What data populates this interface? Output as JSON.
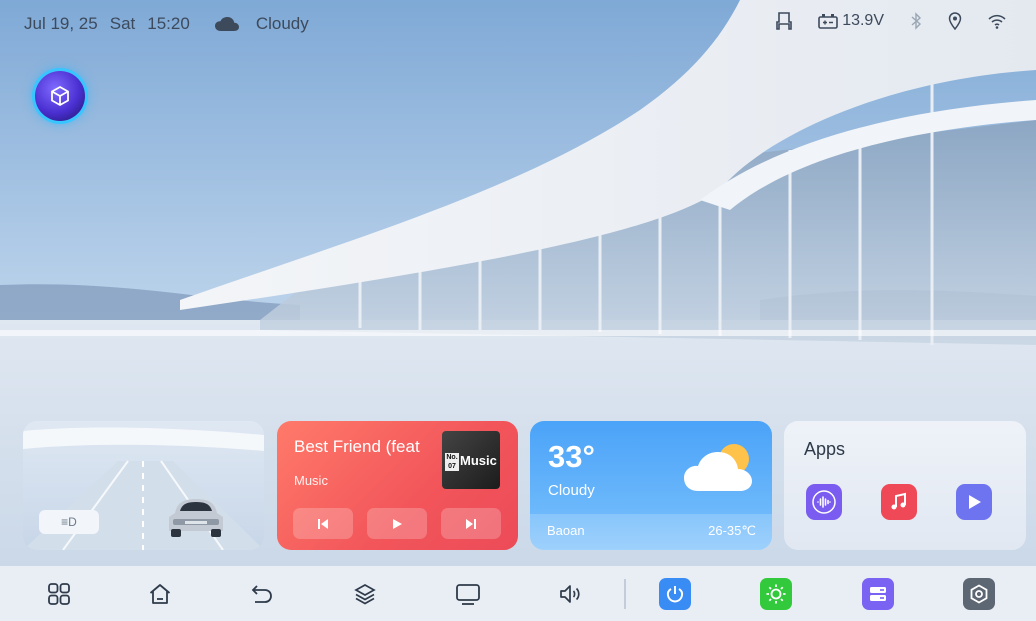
{
  "status_bar": {
    "date": "Jul 19, 25",
    "day": "Sat",
    "time": "15:20",
    "weather": "Cloudy",
    "icons": [
      "cloud-icon",
      "seat-icon",
      "battery-icon",
      "bluetooth-icon",
      "location-icon",
      "wifi-icon"
    ],
    "battery_voltage": "13.9V"
  },
  "assistant": {
    "icon": "cube-icon"
  },
  "vehicle_card": {
    "light_label": "≡D",
    "icons": [
      "car-icon",
      "headlight-icon"
    ]
  },
  "music_card": {
    "title": "Best Friend (feat",
    "subtitle": "Music",
    "album_label": "Music",
    "album_tag": "No. 07",
    "controls": [
      "previous-icon",
      "play-icon",
      "next-icon"
    ]
  },
  "weather_card": {
    "temperature": "33°",
    "condition": "Cloudy",
    "city": "Baoan",
    "range": "26-35℃",
    "icon": "partly-cloudy-icon"
  },
  "apps_card": {
    "title": "Apps",
    "apps": [
      {
        "name": "voice-app",
        "icon": "waveform-icon",
        "color": "#7b5cf0"
      },
      {
        "name": "music-app",
        "icon": "music-note-icon",
        "color": "#ef4856"
      },
      {
        "name": "video-app",
        "icon": "play-icon",
        "color": "#6e73f0"
      }
    ]
  },
  "dock": {
    "items": [
      "apps-grid-icon",
      "home-icon",
      "back-icon",
      "layers-icon",
      "screen-icon",
      "volume-icon"
    ],
    "quick_buttons": [
      {
        "name": "power",
        "icon": "power-icon",
        "color": "#3a8cf5"
      },
      {
        "name": "brightness",
        "icon": "sun-icon",
        "color": "#33c93c"
      },
      {
        "name": "storage",
        "icon": "storage-icon",
        "color": "#7a63f2"
      },
      {
        "name": "settings",
        "icon": "settings-icon",
        "color": "#5d6673"
      }
    ]
  }
}
